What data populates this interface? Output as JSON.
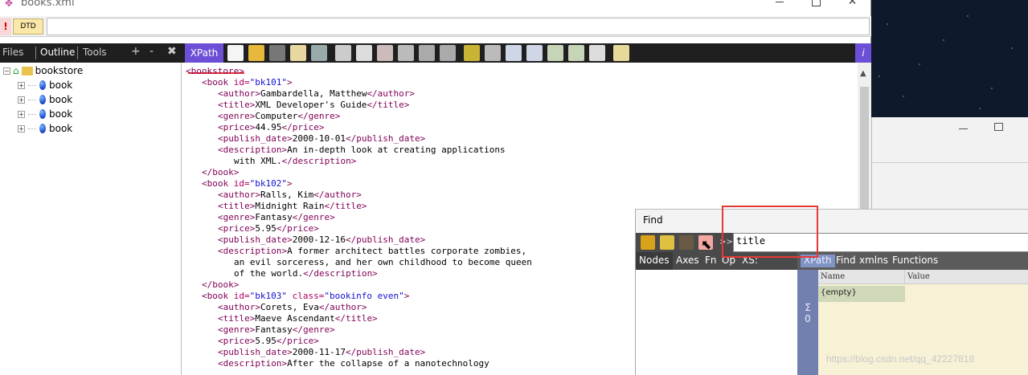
{
  "window": {
    "title": "books.xml"
  },
  "dtd_bar": {
    "warning": "!",
    "dtd_label": "DTD"
  },
  "left_tabs": {
    "files": "Files",
    "outline": "Outline",
    "tools": "Tools",
    "plus": "+",
    "minus": "-",
    "close": "✖"
  },
  "toolbar": {
    "xpath_label": "XPath",
    "info_label": "i"
  },
  "tree": {
    "root": "bookstore",
    "items": [
      "book",
      "book",
      "book",
      "book"
    ]
  },
  "editor": {
    "lines": [
      {
        "indent": 0,
        "html": "<span class='tg'>&lt;</span><span class='tn'>bookstore</span><span class='tg'>&gt;</span>"
      },
      {
        "indent": 1,
        "html": "<span class='tg'>&lt;book </span><span class='an'>id=</span><span class='av'>\"bk101\"</span><span class='tg'>&gt;</span>"
      },
      {
        "indent": 2,
        "html": "<span class='tg'>&lt;author&gt;</span>Gambardella, Matthew<span class='tg'>&lt;/author&gt;</span>"
      },
      {
        "indent": 2,
        "html": "<span class='tg'>&lt;title&gt;</span>XML Developer's Guide<span class='tg'>&lt;/title&gt;</span>"
      },
      {
        "indent": 2,
        "html": "<span class='tg'>&lt;genre&gt;</span>Computer<span class='tg'>&lt;/genre&gt;</span>"
      },
      {
        "indent": 2,
        "html": "<span class='tg'>&lt;price&gt;</span>44.95<span class='tg'>&lt;/price&gt;</span>"
      },
      {
        "indent": 2,
        "html": "<span class='tg'>&lt;publish_date&gt;</span>2000-10-01<span class='tg'>&lt;/publish_date&gt;</span>"
      },
      {
        "indent": 2,
        "html": "<span class='tg'>&lt;description&gt;</span>An in-depth look at creating applications"
      },
      {
        "indent": 3,
        "html": "with XML.<span class='tg'>&lt;/description&gt;</span>"
      },
      {
        "indent": 1,
        "html": "<span class='tg'>&lt;/book&gt;</span>"
      },
      {
        "indent": 1,
        "html": "<span class='tg'>&lt;book </span><span class='an'>id=</span><span class='av'>\"bk102\"</span><span class='tg'>&gt;</span>"
      },
      {
        "indent": 2,
        "html": "<span class='tg'>&lt;author&gt;</span>Ralls, Kim<span class='tg'>&lt;/author&gt;</span>"
      },
      {
        "indent": 2,
        "html": "<span class='tg'>&lt;title&gt;</span>Midnight Rain<span class='tg'>&lt;/title&gt;</span>"
      },
      {
        "indent": 2,
        "html": "<span class='tg'>&lt;genre&gt;</span>Fantasy<span class='tg'>&lt;/genre&gt;</span>"
      },
      {
        "indent": 2,
        "html": "<span class='tg'>&lt;price&gt;</span>5.95<span class='tg'>&lt;/price&gt;</span>"
      },
      {
        "indent": 2,
        "html": "<span class='tg'>&lt;publish_date&gt;</span>2000-12-16<span class='tg'>&lt;/publish_date&gt;</span>"
      },
      {
        "indent": 2,
        "html": "<span class='tg'>&lt;description&gt;</span>A former architect battles corporate zombies,"
      },
      {
        "indent": 3,
        "html": "an evil sorceress, and her own childhood to become queen"
      },
      {
        "indent": 3,
        "html": "of the world.<span class='tg'>&lt;/description&gt;</span>"
      },
      {
        "indent": 1,
        "html": "<span class='tg'>&lt;/book&gt;</span>"
      },
      {
        "indent": 1,
        "html": "<span class='tg'>&lt;book </span><span class='an'>id=</span><span class='av'>\"bk103\"</span> <span class='an'>class=</span><span class='av'>\"bookinfo even\"</span><span class='tg'>&gt;</span>"
      },
      {
        "indent": 2,
        "html": "<span class='tg'>&lt;author&gt;</span>Corets, Eva<span class='tg'>&lt;/author&gt;</span>"
      },
      {
        "indent": 2,
        "html": "<span class='tg'>&lt;title&gt;</span>Maeve Ascendant<span class='tg'>&lt;/title&gt;</span>"
      },
      {
        "indent": 2,
        "html": "<span class='tg'>&lt;genre&gt;</span>Fantasy<span class='tg'>&lt;/genre&gt;</span>"
      },
      {
        "indent": 2,
        "html": "<span class='tg'>&lt;price&gt;</span>5.95<span class='tg'>&lt;/price&gt;</span>"
      },
      {
        "indent": 2,
        "html": "<span class='tg'>&lt;publish_date&gt;</span>2000-11-17<span class='tg'>&lt;/publish_date&gt;</span>"
      },
      {
        "indent": 2,
        "html": "<span class='tg'>&lt;description&gt;</span>After the collapse of a nanotechnology"
      }
    ]
  },
  "find": {
    "title": "Find",
    "separator": ">>",
    "query": "title",
    "left_tabs": [
      "Nodes",
      "Axes",
      "Fn",
      "Op",
      "XS:"
    ],
    "right_tabs": [
      "XPath",
      "Find",
      "xmlns",
      "Functions"
    ],
    "sigma": "Σ",
    "count": "0",
    "col_name": "Name",
    "col_value": "Value",
    "result_cell": "{empty}"
  },
  "watermark": "https://blog.csdn.net/qq_42227818"
}
